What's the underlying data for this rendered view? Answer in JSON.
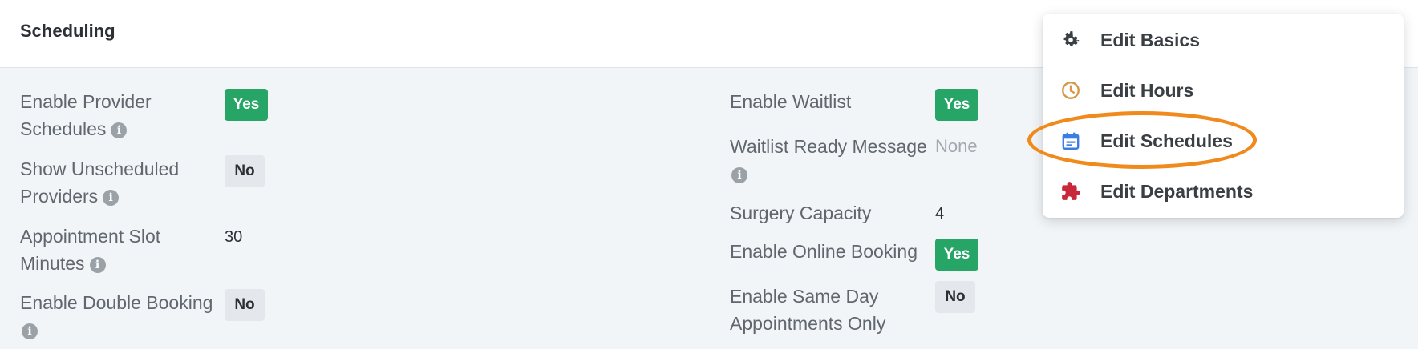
{
  "header": {
    "title": "Scheduling"
  },
  "left_fields": [
    {
      "label_line1": "Enable Provider",
      "label_line2": "Schedules",
      "value": "Yes",
      "type": "yes"
    },
    {
      "label_line1": "Show Unscheduled",
      "label_line2": "Providers",
      "value": "No",
      "type": "no"
    },
    {
      "label_line1": "Appointment Slot",
      "label_line2": "Minutes",
      "value": "30",
      "type": "text"
    },
    {
      "label_line1": "Enable Double Booking",
      "label_line2": "",
      "value": "No",
      "type": "no"
    }
  ],
  "right_fields": [
    {
      "label_line1": "Enable Waitlist",
      "label_line2": "",
      "value": "Yes",
      "type": "yes"
    },
    {
      "label_line1": "Waitlist Ready Message",
      "label_line2": "",
      "value": "None",
      "type": "muted"
    },
    {
      "label_line1": "Surgery Capacity",
      "label_line2": "",
      "value": "4",
      "type": "text"
    },
    {
      "label_line1": "Enable Online Booking",
      "label_line2": "",
      "value": "Yes",
      "type": "yes"
    },
    {
      "label_line1": "Enable Same Day",
      "label_line2": "Appointments Only",
      "value": "No",
      "type": "no"
    }
  ],
  "info_glyph": "i",
  "menu": {
    "items": [
      {
        "label": "Edit Basics",
        "icon": "gear-icon",
        "color": "#3a3f44"
      },
      {
        "label": "Edit Hours",
        "icon": "clock-icon",
        "color": "#d49a4a"
      },
      {
        "label": "Edit Schedules",
        "icon": "calendar-icon",
        "color": "#3b7de0"
      },
      {
        "label": "Edit Departments",
        "icon": "puzzle-icon",
        "color": "#c8283a"
      }
    ]
  },
  "annotation": {
    "color": "#f08a1d",
    "target": "Edit Schedules"
  }
}
